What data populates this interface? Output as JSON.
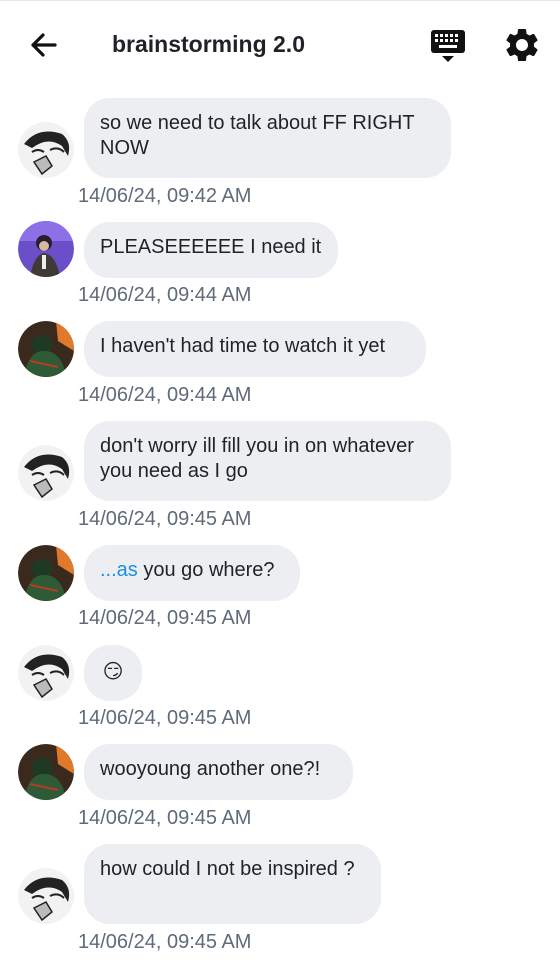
{
  "header": {
    "title": "brainstorming 2.0",
    "back_icon": "arrow-left-icon",
    "keyboard_icon": "keyboard-icon",
    "settings_icon": "gear-icon"
  },
  "colors": {
    "bubble": "#eceef1",
    "timestamp": "#5f6b7a",
    "mention": "#1d8fe1",
    "text": "#1f2328"
  },
  "messages": [
    {
      "avatar": "manga-avatar",
      "text": "so we need to talk about FF RIGHT NOW",
      "time": "14/06/24, 09:42 AM"
    },
    {
      "avatar": "purple-photo-avatar",
      "text": "PLEASEEEEEE I need it",
      "time": "14/06/24, 09:44 AM"
    },
    {
      "avatar": "green-photo-avatar",
      "text": "I haven't had time to watch it yet",
      "time": "14/06/24, 09:44 AM"
    },
    {
      "avatar": "manga-avatar",
      "text": "don't worry ill fill you in on whatever you need as I go",
      "time": "14/06/24, 09:45 AM"
    },
    {
      "avatar": "green-photo-avatar",
      "mention": "...as",
      "text": " you go where?",
      "time": "14/06/24, 09:45 AM"
    },
    {
      "avatar": "manga-avatar",
      "text": "😏",
      "time": "14/06/24, 09:45 AM"
    },
    {
      "avatar": "green-photo-avatar",
      "text": "wooyoung another one?!",
      "time": "14/06/24, 09:45 AM"
    },
    {
      "avatar": "manga-avatar",
      "text": "how could I not be inspired ?",
      "time": "14/06/24, 09:45 AM"
    }
  ]
}
